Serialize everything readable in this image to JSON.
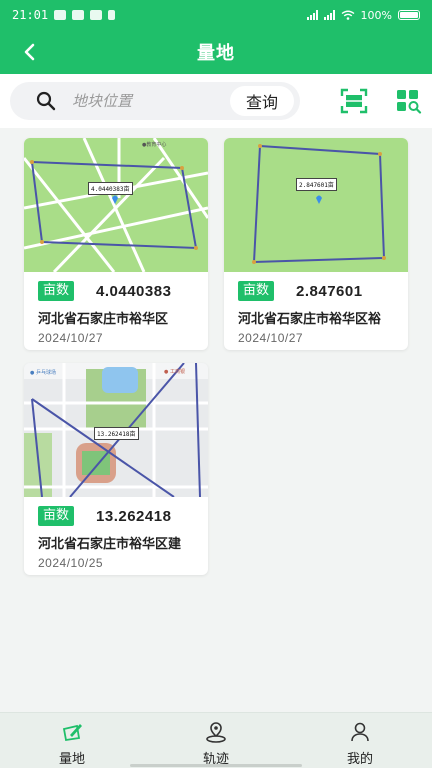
{
  "status_bar": {
    "time": "21:01",
    "battery": "100%"
  },
  "header": {
    "title": "量地",
    "back_icon": "chevron-left-icon"
  },
  "search": {
    "placeholder": "地块位置",
    "button_label": "查询",
    "scan_icon": "scan-icon",
    "grid_search_icon": "grid-search-icon"
  },
  "cards": [
    {
      "unit": "亩数",
      "area": "4.0440383",
      "location": "河北省石家庄市裕华区",
      "date": "2024/10/27",
      "map_label": "4.0440383亩"
    },
    {
      "unit": "亩数",
      "area": "2.847601",
      "location": "河北省石家庄市裕华区裕",
      "date": "2024/10/27",
      "map_label": "2.847601亩"
    },
    {
      "unit": "亩数",
      "area": "13.262418",
      "location": "河北省石家庄市裕华区建",
      "date": "2024/10/25",
      "map_label": "13.262418亩"
    }
  ],
  "nav": {
    "items": [
      {
        "label": "量地",
        "icon": "measure-icon"
      },
      {
        "label": "轨迹",
        "icon": "track-icon"
      },
      {
        "label": "我的",
        "icon": "user-icon"
      }
    ]
  },
  "colors": {
    "primary": "#1fbf6a",
    "polygon": "#4a55a8",
    "map_green": "#a9dd88"
  }
}
